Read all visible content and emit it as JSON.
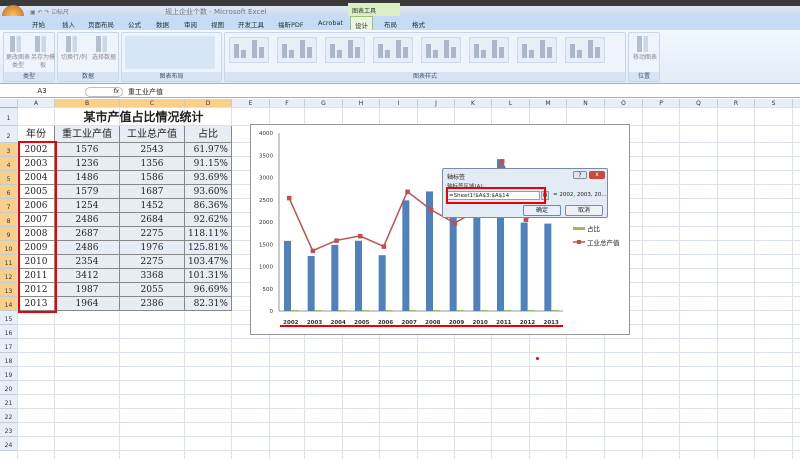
{
  "window": {
    "title": "规上企业个数 - Microsoft Excel",
    "context_tab": "图表工具"
  },
  "qat": {
    "ruler_label": "标尺"
  },
  "tabs": [
    {
      "label": "开始"
    },
    {
      "label": "插入"
    },
    {
      "label": "页面布局"
    },
    {
      "label": "公式"
    },
    {
      "label": "数据"
    },
    {
      "label": "审阅"
    },
    {
      "label": "视图"
    },
    {
      "label": "开发工具"
    },
    {
      "label": "福昕PDF"
    },
    {
      "label": "Acrobat"
    },
    {
      "label": "设计",
      "active": true
    },
    {
      "label": "布局"
    },
    {
      "label": "格式"
    }
  ],
  "ribbon": {
    "groups": [
      {
        "label": "类型"
      },
      {
        "label": "数据"
      },
      {
        "label": "图表布局"
      },
      {
        "label": "图表样式"
      },
      {
        "label": "位置"
      }
    ],
    "buttons": {
      "change_type": "更改图表类型",
      "save_template": "另存为模板",
      "switch_row_col": "切换行/列",
      "select_data": "选择数据",
      "move_chart": "移动图表"
    }
  },
  "formula_bar": {
    "name_box": "A3",
    "fx": "fx",
    "value": "重工业产值"
  },
  "columns": [
    "A",
    "B",
    "C",
    "D",
    "E",
    "F",
    "G",
    "H",
    "I",
    "J",
    "K",
    "L",
    "M",
    "N",
    "O",
    "P",
    "Q",
    "R",
    "S"
  ],
  "rows": [
    "1",
    "2",
    "3",
    "4",
    "5",
    "6",
    "7",
    "8",
    "9",
    "10",
    "11",
    "12",
    "13",
    "14",
    "15",
    "16",
    "17",
    "18",
    "19",
    "20",
    "21",
    "22",
    "23",
    "24"
  ],
  "sheet": {
    "title": "某市产值占比情况统计",
    "headers": [
      "年份",
      "重工业产值",
      "工业总产值",
      "占比"
    ],
    "data": [
      [
        "2002",
        "1576",
        "2543",
        "61.97%"
      ],
      [
        "2003",
        "1236",
        "1356",
        "91.15%"
      ],
      [
        "2004",
        "1486",
        "1586",
        "93.69%"
      ],
      [
        "2005",
        "1579",
        "1687",
        "93.60%"
      ],
      [
        "2006",
        "1254",
        "1452",
        "86.36%"
      ],
      [
        "2007",
        "2486",
        "2684",
        "92.62%"
      ],
      [
        "2008",
        "2687",
        "2275",
        "118.11%"
      ],
      [
        "2009",
        "2486",
        "1976",
        "125.81%"
      ],
      [
        "2010",
        "2354",
        "2275",
        "103.47%"
      ],
      [
        "2011",
        "3412",
        "3368",
        "101.31%"
      ],
      [
        "2012",
        "1987",
        "2055",
        "96.69%"
      ],
      [
        "2013",
        "1964",
        "2386",
        "82.31%"
      ]
    ]
  },
  "chart_data": {
    "type": "bar",
    "categories": [
      "2002",
      "2003",
      "2004",
      "2005",
      "2006",
      "2007",
      "2008",
      "2009",
      "2010",
      "2011",
      "2012",
      "2013"
    ],
    "ylim": [
      0,
      4000
    ],
    "yticks": [
      "0",
      "500",
      "1000",
      "1500",
      "2000",
      "2500",
      "3000",
      "3500",
      "4000"
    ],
    "series": [
      {
        "name": "重工业产值",
        "type": "bar",
        "color": "#4f81bd",
        "values": [
          1576,
          1236,
          1486,
          1579,
          1254,
          2486,
          2687,
          2486,
          2354,
          3412,
          1987,
          1964
        ]
      },
      {
        "name": "占比",
        "type": "bar",
        "color": "#9bbb59",
        "values": [
          0.6197,
          0.9115,
          0.9369,
          0.936,
          0.8636,
          0.9262,
          1.1811,
          1.2581,
          1.0347,
          1.0131,
          0.9669,
          0.8231
        ]
      },
      {
        "name": "工业总产值",
        "type": "line",
        "color": "#c0504d",
        "values": [
          2543,
          1356,
          1586,
          1687,
          1452,
          2684,
          2275,
          1976,
          2275,
          3368,
          2055,
          2386
        ]
      }
    ],
    "legend": "right",
    "legend_visible": [
      "产值",
      "占比",
      "工业总产值"
    ]
  },
  "dialog": {
    "title": "轴标签",
    "label": "轴标签区域(A):",
    "input": "=Sheet1!$A$3:$A$14",
    "preview": "= 2002, 2003, 20...",
    "ok": "确定",
    "cancel": "取消",
    "help": "?",
    "close": "x"
  },
  "colors": {
    "highlight": "#e00000",
    "selected_header": "#f9d08a"
  }
}
